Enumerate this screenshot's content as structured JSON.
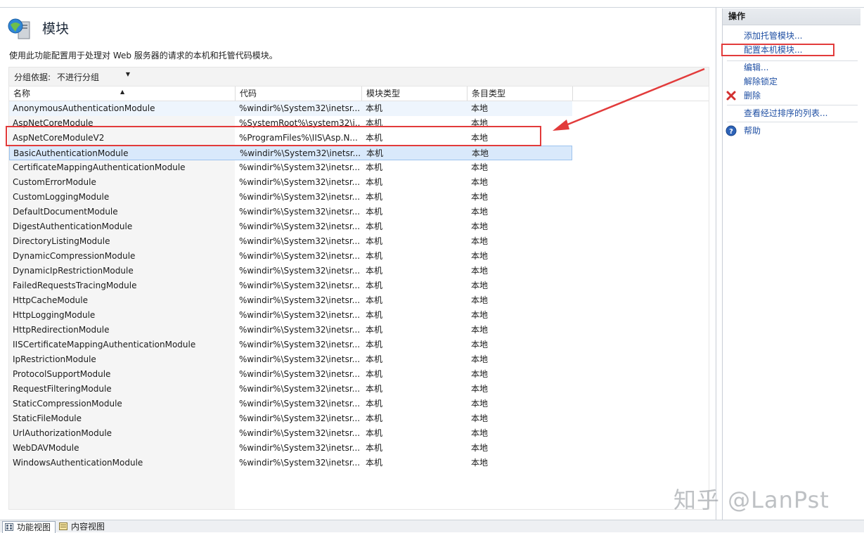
{
  "page": {
    "title": "模块",
    "description": "使用此功能配置用于处理对 Web 服务器的请求的本机和托管代码模块。",
    "group_by_label": "分组依据:",
    "group_by_value": "不进行分组"
  },
  "table": {
    "columns": [
      "名称",
      "代码",
      "模块类型",
      "条目类型"
    ],
    "rows": [
      {
        "name": "AnonymousAuthenticationModule",
        "code": "%windir%\\System32\\inetsr...",
        "type": "本机",
        "entry": "本地"
      },
      {
        "name": "AspNetCoreModule",
        "code": "%SystemRoot%\\system32\\i...",
        "type": "本机",
        "entry": "本地"
      },
      {
        "name": "AspNetCoreModuleV2",
        "code": "%ProgramFiles%\\IIS\\Asp.N...",
        "type": "本机",
        "entry": "本地"
      },
      {
        "name": "BasicAuthenticationModule",
        "code": "%windir%\\System32\\inetsr...",
        "type": "本机",
        "entry": "本地"
      },
      {
        "name": "CertificateMappingAuthenticationModule",
        "code": "%windir%\\System32\\inetsr...",
        "type": "本机",
        "entry": "本地"
      },
      {
        "name": "CustomErrorModule",
        "code": "%windir%\\System32\\inetsr...",
        "type": "本机",
        "entry": "本地"
      },
      {
        "name": "CustomLoggingModule",
        "code": "%windir%\\System32\\inetsr...",
        "type": "本机",
        "entry": "本地"
      },
      {
        "name": "DefaultDocumentModule",
        "code": "%windir%\\System32\\inetsr...",
        "type": "本机",
        "entry": "本地"
      },
      {
        "name": "DigestAuthenticationModule",
        "code": "%windir%\\System32\\inetsr...",
        "type": "本机",
        "entry": "本地"
      },
      {
        "name": "DirectoryListingModule",
        "code": "%windir%\\System32\\inetsr...",
        "type": "本机",
        "entry": "本地"
      },
      {
        "name": "DynamicCompressionModule",
        "code": "%windir%\\System32\\inetsr...",
        "type": "本机",
        "entry": "本地"
      },
      {
        "name": "DynamicIpRestrictionModule",
        "code": "%windir%\\System32\\inetsr...",
        "type": "本机",
        "entry": "本地"
      },
      {
        "name": "FailedRequestsTracingModule",
        "code": "%windir%\\System32\\inetsr...",
        "type": "本机",
        "entry": "本地"
      },
      {
        "name": "HttpCacheModule",
        "code": "%windir%\\System32\\inetsr...",
        "type": "本机",
        "entry": "本地"
      },
      {
        "name": "HttpLoggingModule",
        "code": "%windir%\\System32\\inetsr...",
        "type": "本机",
        "entry": "本地"
      },
      {
        "name": "HttpRedirectionModule",
        "code": "%windir%\\System32\\inetsr...",
        "type": "本机",
        "entry": "本地"
      },
      {
        "name": "IISCertificateMappingAuthenticationModule",
        "code": "%windir%\\System32\\inetsr...",
        "type": "本机",
        "entry": "本地"
      },
      {
        "name": "IpRestrictionModule",
        "code": "%windir%\\System32\\inetsr...",
        "type": "本机",
        "entry": "本地"
      },
      {
        "name": "ProtocolSupportModule",
        "code": "%windir%\\System32\\inetsr...",
        "type": "本机",
        "entry": "本地"
      },
      {
        "name": "RequestFilteringModule",
        "code": "%windir%\\System32\\inetsr...",
        "type": "本机",
        "entry": "本地"
      },
      {
        "name": "StaticCompressionModule",
        "code": "%windir%\\System32\\inetsr...",
        "type": "本机",
        "entry": "本地"
      },
      {
        "name": "StaticFileModule",
        "code": "%windir%\\System32\\inetsr...",
        "type": "本机",
        "entry": "本地"
      },
      {
        "name": "UrlAuthorizationModule",
        "code": "%windir%\\System32\\inetsr...",
        "type": "本机",
        "entry": "本地"
      },
      {
        "name": "WebDAVModule",
        "code": "%windir%\\System32\\inetsr...",
        "type": "本机",
        "entry": "本地"
      },
      {
        "name": "WindowsAuthenticationModule",
        "code": "%windir%\\System32\\inetsr...",
        "type": "本机",
        "entry": "本地"
      }
    ]
  },
  "actions": {
    "header": "操作",
    "add_managed": "添加托管模块...",
    "configure_native": "配置本机模块...",
    "edit": "编辑...",
    "unlock": "解除锁定",
    "delete": "删除",
    "view_ordered": "查看经过排序的列表...",
    "help": "帮助"
  },
  "bottom_tabs": {
    "features_view": "功能视图",
    "content_view": "内容视图"
  },
  "watermark": "知乎 @LanPst",
  "colors": {
    "link": "#1f4fa3",
    "selection": "#d9e9fb",
    "annotation_red": "#e23b3b"
  },
  "icons": [
    "modules-icon",
    "delete-x-icon",
    "help-icon",
    "features-view-icon",
    "content-view-icon"
  ]
}
